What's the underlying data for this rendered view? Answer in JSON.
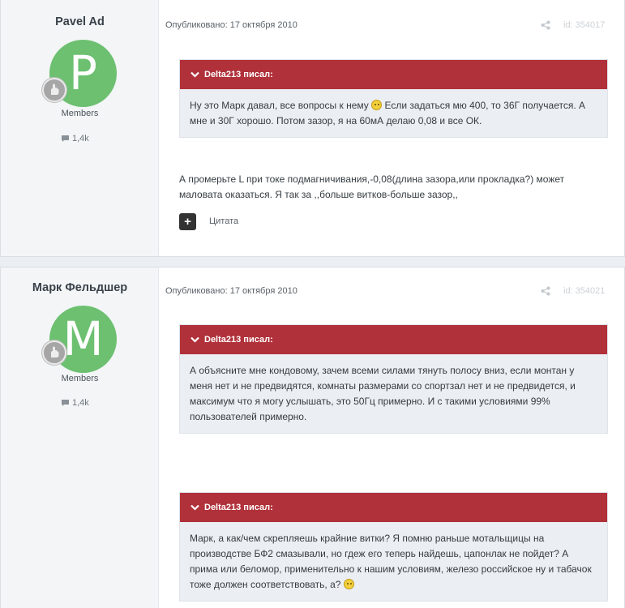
{
  "posts": [
    {
      "author": {
        "name": "Pavel Ad",
        "avatar_letter": "P",
        "avatar_color": "#6cc070",
        "group": "Members",
        "reputation": "1,4k"
      },
      "date": "Опубликовано: 17 октября 2010",
      "id_text": "id: 354017",
      "quotes": [
        {
          "author_label": "Delta213 писал:",
          "text_before_emoji": "Ну это Марк давал, все вопросы к нему ",
          "text_after_emoji": " Если задаться мю 400, то 36Г получается. А мне и 30Г хорошо. Потом зазор, я на 60мА делаю 0,08 и все ОК."
        }
      ],
      "reply": "А промерьте L при токе подмагничивания,-0,08(длина зазора,или прокладка?) может маловата оказаться. Я так за ,,больше витков-больше зазор,,",
      "quote_button_label": "Цитата"
    },
    {
      "author": {
        "name": "Марк Фельдшер",
        "avatar_letter": "M",
        "avatar_color": "#6cc070",
        "group": "Members",
        "reputation": "1,4k"
      },
      "date": "Опубликовано: 17 октября 2010",
      "id_text": "id: 354021",
      "quotes": [
        {
          "author_label": "Delta213 писал:",
          "text": "А объясните мне кондовому, зачем всеми силами тянуть полосу вниз, если монтан у меня нет и не предвидятся, комнаты размерами со спортзал нет и не предвидется, и максимум что я могу услышать, это 50Гц примерно. И с такими условиями 99% пользователей примерно."
        },
        {
          "author_label": "Delta213 писал:",
          "text_before_emoji": "Марк, а как/чем скрепляешь крайние витки? Я помню раньше мотальщицы на производстве БФ2 смазывали, но гдеж его теперь найдешь, цапонлак не пойдет? А прима или беломор, применительно к нашим условиям, железо российское ну и табачок тоже должен соответствовать, а? ",
          "text_after_emoji": ""
        }
      ]
    }
  ],
  "colors": {
    "quote_header": "#b0313a",
    "quote_body": "#ebeef2",
    "avatar": "#6cc070",
    "page_background": "#ebeef2"
  },
  "icons": {
    "share": "share-icon",
    "chevron": "chevron-down-icon",
    "comment": "comment-icon",
    "rank": "rank-badge-icon",
    "plus": "plus-icon",
    "emoji": "smiley-emoji-icon"
  }
}
